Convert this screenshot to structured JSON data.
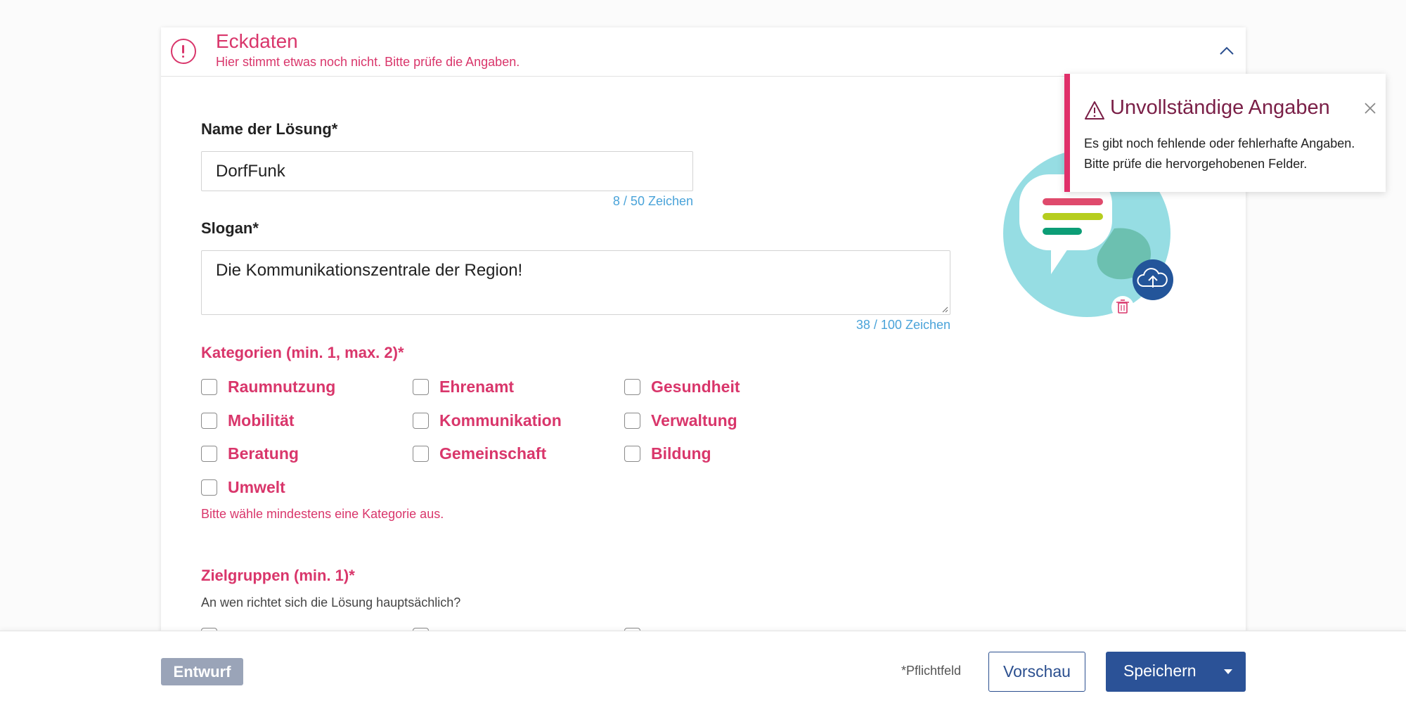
{
  "section": {
    "title": "Eckdaten",
    "error_subtitle": "Hier stimmt etwas noch nicht. Bitte prüfe die Angaben."
  },
  "fields": {
    "name": {
      "label": "Name der Lösung*",
      "value": "DorfFunk",
      "counter": "8 / 50 Zeichen"
    },
    "slogan": {
      "label": "Slogan*",
      "value": "Die Kommunikationszentrale der Region!",
      "counter": "38 / 100 Zeichen"
    }
  },
  "categories": {
    "label": "Kategorien (min. 1, max. 2)*",
    "items": [
      "Raumnutzung",
      "Ehrenamt",
      "Gesundheit",
      "Mobilität",
      "Kommunikation",
      "Verwaltung",
      "Beratung",
      "Gemeinschaft",
      "Bildung",
      "Umwelt"
    ],
    "checked": [
      false,
      false,
      false,
      false,
      false,
      false,
      false,
      false,
      false,
      false
    ],
    "error": "Bitte wähle mindestens eine Kategorie aus."
  },
  "target_groups": {
    "label": "Zielgruppen (min. 1)*",
    "help": "An wen richtet sich die Lösung hauptsächlich?"
  },
  "toast": {
    "title": "Unvollständige Angaben",
    "line1": "Es gibt noch fehlende oder fehlerhafte Angaben.",
    "line2": "Bitte prüfe die hervorgehobenen Felder."
  },
  "footer": {
    "status_badge": "Entwurf",
    "required_note": "*Pflichtfeld",
    "preview_label": "Vorschau",
    "save_label": "Speichern"
  },
  "colors": {
    "error": "#d9366b",
    "primary": "#2b5297",
    "counter": "#4aa3d9",
    "badge": "#9aa4b8"
  },
  "icons": [
    "error-circle-icon",
    "chevron-up-icon",
    "warning-icon",
    "close-icon",
    "upload-cloud-icon",
    "trash-icon",
    "caret-down-icon"
  ]
}
